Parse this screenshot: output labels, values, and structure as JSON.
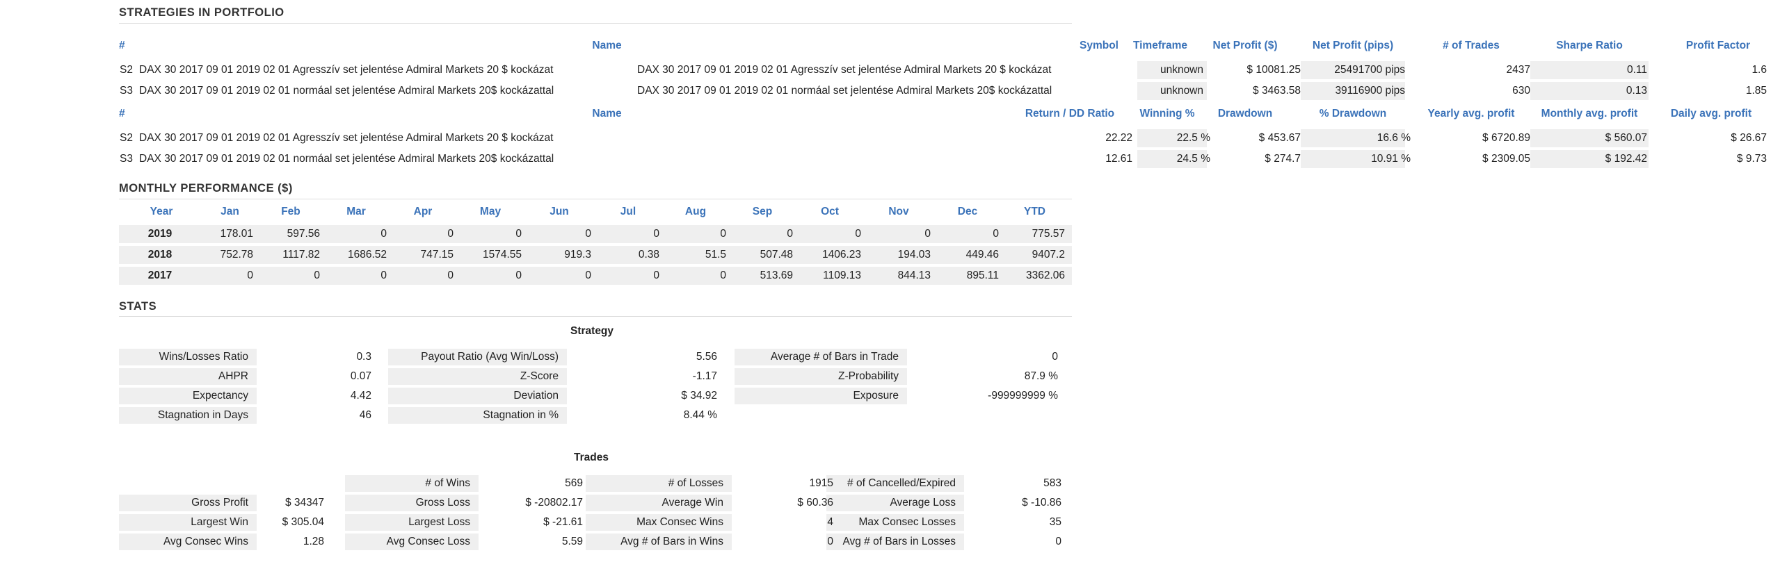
{
  "portfolio": {
    "title": "STRATEGIES IN PORTFOLIO",
    "headers1": [
      "#",
      "Name",
      "Symbol",
      "Timeframe",
      "Net Profit ($)",
      "Net Profit (pips)",
      "# of Trades",
      "Sharpe Ratio",
      "Profit Factor"
    ],
    "rows1": [
      {
        "id": "S2",
        "name": "DAX 30 2017 09 01 2019 02 01 Agresszív set jelentése Admiral Markets 20 $ kockázat",
        "symbol": "DAX 30 2017 09 01 2019 02 01 Agresszív set jelentése Admiral Markets 20 $ kockázat",
        "timeframe": "unknown",
        "net_profit": "$ 10081.25",
        "net_pips": "25491700 pips",
        "trades": "2437",
        "sharpe": "0.11",
        "pf": "1.6"
      },
      {
        "id": "S3",
        "name": "DAX 30 2017 09 01 2019 02 01 normáal set jelentése Admiral Markets 20$ kockázattal",
        "symbol": "DAX 30 2017 09 01 2019 02 01 normáal set jelentése Admiral Markets 20$ kockázattal",
        "timeframe": "unknown",
        "net_profit": "$ 3463.58",
        "net_pips": "39116900 pips",
        "trades": "630",
        "sharpe": "0.13",
        "pf": "1.85"
      }
    ],
    "headers2": [
      "#",
      "Name",
      "Return / DD Ratio",
      "Winning %",
      "Drawdown",
      "% Drawdown",
      "Yearly avg. profit",
      "Monthly avg. profit",
      "Daily avg. profit"
    ],
    "rows2": [
      {
        "id": "S2",
        "name": "DAX 30 2017 09 01 2019 02 01 Agresszív set jelentése Admiral Markets 20 $ kockázat",
        "ret_dd": "22.22",
        "win": "22.5 %",
        "dd": "$ 453.67",
        "pdd": "16.6 %",
        "yearly": "$ 6720.89",
        "monthly": "$ 560.07",
        "daily": "$ 26.67"
      },
      {
        "id": "S3",
        "name": "DAX 30 2017 09 01 2019 02 01 normáal set jelentése Admiral Markets 20$ kockázattal",
        "ret_dd": "12.61",
        "win": "24.5 %",
        "dd": "$ 274.7",
        "pdd": "10.91 %",
        "yearly": "$ 2309.05",
        "monthly": "$ 192.42",
        "daily": "$ 9.73"
      }
    ]
  },
  "monthly": {
    "title": "MONTHLY PERFORMANCE ($)",
    "headers": [
      "Year",
      "Jan",
      "Feb",
      "Mar",
      "Apr",
      "May",
      "Jun",
      "Jul",
      "Aug",
      "Sep",
      "Oct",
      "Nov",
      "Dec",
      "YTD"
    ],
    "rows": [
      [
        "2019",
        "178.01",
        "597.56",
        "0",
        "0",
        "0",
        "0",
        "0",
        "0",
        "0",
        "0",
        "0",
        "0",
        "775.57"
      ],
      [
        "2018",
        "752.78",
        "1117.82",
        "1686.52",
        "747.15",
        "1574.55",
        "919.3",
        "0.38",
        "51.5",
        "507.48",
        "1406.23",
        "194.03",
        "449.46",
        "9407.2"
      ],
      [
        "2017",
        "0",
        "0",
        "0",
        "0",
        "0",
        "0",
        "0",
        "0",
        "513.69",
        "1109.13",
        "844.13",
        "895.11",
        "3362.06"
      ]
    ]
  },
  "stats": {
    "title": "STATS",
    "strategy_title": "Strategy",
    "strategy_rows": [
      [
        "Wins/Losses Ratio",
        "0.3",
        "Payout Ratio (Avg Win/Loss)",
        "5.56",
        "Average # of Bars in Trade",
        "0"
      ],
      [
        "AHPR",
        "0.07",
        "Z-Score",
        "-1.17",
        "Z-Probability",
        "87.9 %"
      ],
      [
        "Expectancy",
        "4.42",
        "Deviation",
        "$ 34.92",
        "Exposure",
        "-999999999 %"
      ],
      [
        "Stagnation in Days",
        "46",
        "Stagnation in %",
        "8.44 %",
        "",
        ""
      ]
    ],
    "trades_title": "Trades",
    "trades_rows": [
      [
        "",
        "",
        "# of Wins",
        "569",
        "# of Losses",
        "1915",
        "# of Cancelled/Expired",
        "583"
      ],
      [
        "Gross Profit",
        "$ 34347",
        "Gross Loss",
        "$ -20802.17",
        "Average Win",
        "$ 60.36",
        "Average Loss",
        "$ -10.86"
      ],
      [
        "Largest Win",
        "$ 305.04",
        "Largest Loss",
        "$ -21.61",
        "Max Consec Wins",
        "4",
        "Max Consec Losses",
        "35"
      ],
      [
        "Avg Consec Wins",
        "1.28",
        "Avg Consec Loss",
        "5.59",
        "Avg # of Bars in Wins",
        "0",
        "Avg # of Bars in Losses",
        "0"
      ]
    ]
  }
}
